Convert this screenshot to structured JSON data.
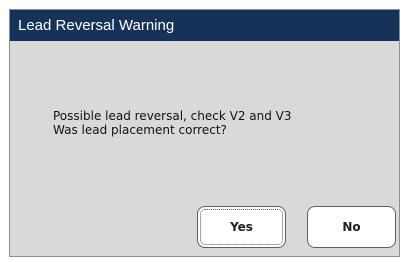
{
  "dialog": {
    "title": "Lead Reversal Warning",
    "message_line1": "Possible lead reversal, check V2 and V3",
    "message_line2": "Was lead placement correct?",
    "yes_label": "Yes",
    "no_label": "No"
  },
  "colors": {
    "titlebar": "#163258",
    "dialog_background": "#d9d9d9",
    "button_background": "#ffffff"
  }
}
